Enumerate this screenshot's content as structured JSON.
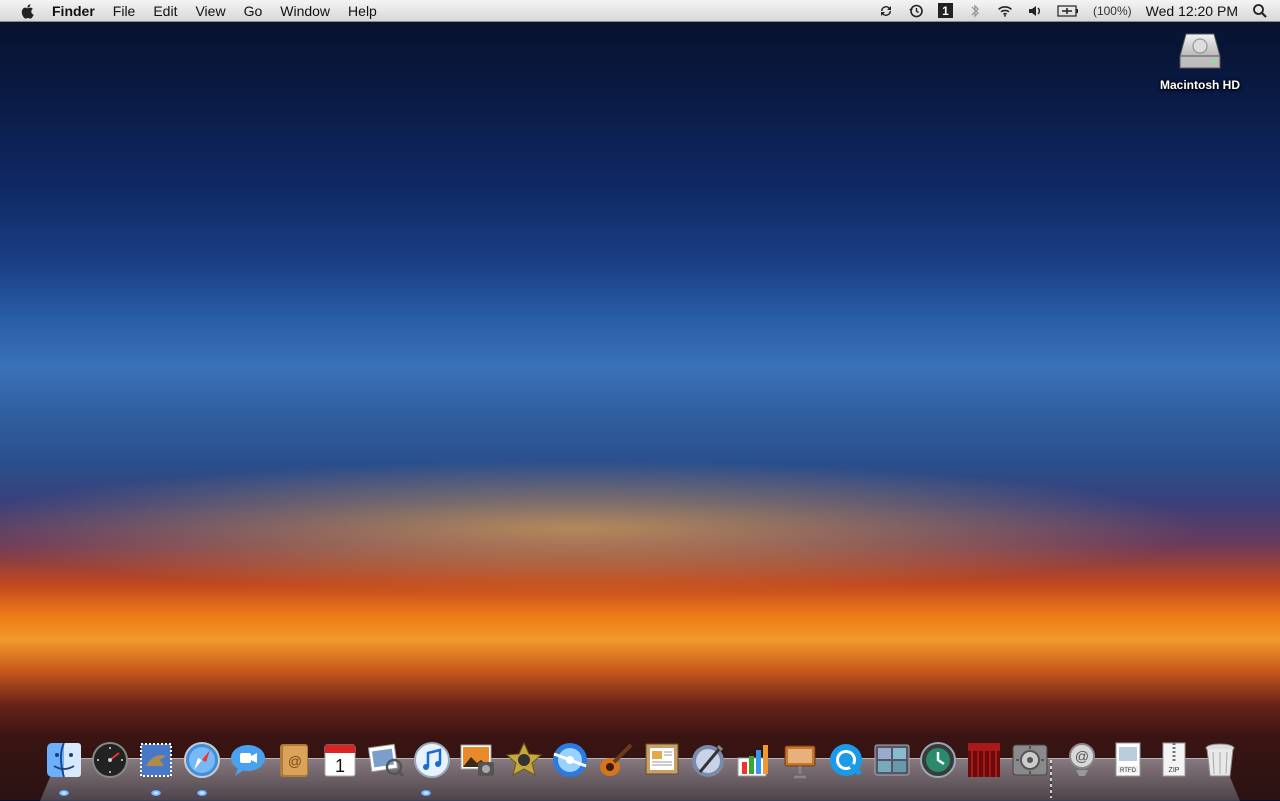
{
  "menubar": {
    "apple_icon": "apple-icon",
    "app_name": "Finder",
    "items": [
      "File",
      "Edit",
      "View",
      "Go",
      "Window",
      "Help"
    ],
    "status": {
      "sync_icon": "sync-icon",
      "time_machine_icon": "time-machine-icon",
      "spaces_number": "1",
      "bluetooth_icon": "bluetooth-icon",
      "wifi_icon": "wifi-icon",
      "volume_icon": "volume-icon",
      "battery_icon": "battery-icon",
      "battery_text": "(100%)",
      "clock": "Wed 12:20 PM",
      "spotlight_icon": "spotlight-icon"
    }
  },
  "desktop": {
    "drive_label": "Macintosh HD"
  },
  "dock": {
    "apps": [
      {
        "name": "finder-icon"
      },
      {
        "name": "dashboard-icon"
      },
      {
        "name": "mail-icon"
      },
      {
        "name": "safari-icon"
      },
      {
        "name": "ichat-icon"
      },
      {
        "name": "address-book-icon"
      },
      {
        "name": "ical-icon",
        "label": "1"
      },
      {
        "name": "preview-icon"
      },
      {
        "name": "itunes-icon"
      },
      {
        "name": "iphoto-icon"
      },
      {
        "name": "imovie-icon"
      },
      {
        "name": "idvd-icon"
      },
      {
        "name": "garageband-icon"
      },
      {
        "name": "iweb-icon"
      },
      {
        "name": "script-editor-icon"
      },
      {
        "name": "numbers-icon"
      },
      {
        "name": "keynote-icon"
      },
      {
        "name": "quicktime-icon"
      },
      {
        "name": "spaces-icon"
      },
      {
        "name": "time-machine-icon"
      },
      {
        "name": "front-row-icon"
      },
      {
        "name": "system-preferences-icon"
      }
    ],
    "stacks": [
      {
        "name": "downloads-stack-icon"
      },
      {
        "name": "rtfd-document-icon",
        "label": "RTFD"
      },
      {
        "name": "zip-archive-icon",
        "label": "ZIP"
      },
      {
        "name": "trash-icon"
      }
    ],
    "running_apps": [
      "finder-icon",
      "mail-icon",
      "safari-icon",
      "itunes-icon"
    ]
  }
}
